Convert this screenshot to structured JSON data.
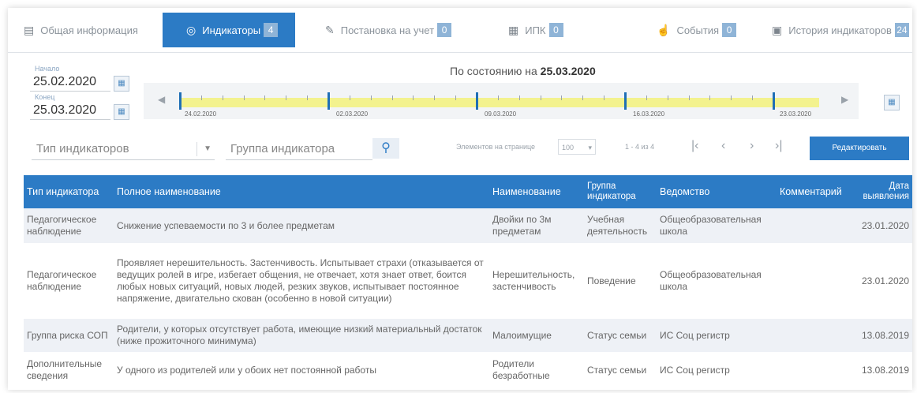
{
  "tabs": [
    {
      "icon": "id-card-icon",
      "label": "Общая информация",
      "badge": ""
    },
    {
      "icon": "target-icon",
      "label": "Индикаторы",
      "badge": "4"
    },
    {
      "icon": "edit-icon",
      "label": "Постановка на учет",
      "badge": "0"
    },
    {
      "icon": "calendar-grid-icon",
      "label": "ИПК",
      "badge": "0"
    },
    {
      "icon": "hand-pointer-icon",
      "label": "События",
      "badge": "0"
    },
    {
      "icon": "calendar-history-icon",
      "label": "История индикаторов",
      "badge": "24"
    }
  ],
  "filters": {
    "start_label": "Начало",
    "start_value": "25.02.2020",
    "end_label": "Конец",
    "end_value": "25.03.2020",
    "as_of_prefix": "По состоянию на",
    "as_of_date": "25.03.2020"
  },
  "timeline": {
    "labels": [
      "24.02.2020",
      "02.03.2020",
      "09.03.2020",
      "16.03.2020",
      "23.03.2020"
    ]
  },
  "toolbar": {
    "type_placeholder": "Тип индикаторов",
    "group_placeholder": "Группа индикатора",
    "per_page_label": "Элементов на странице",
    "per_page_value": "100",
    "range_text": "1 - 4 из 4",
    "edit_label": "Редактировать"
  },
  "table": {
    "headers": [
      "Тип индикатора",
      "Полное наименование",
      "Наименование",
      "Группа индикатора",
      "Ведомство",
      "Комментарий",
      "Дата выявления"
    ],
    "rows": [
      {
        "type": "Педагогическое наблюдение",
        "full": "Снижение успеваемости по 3 и более предметам",
        "name": "Двойки по 3м предметам",
        "group": "Учебная деятельность",
        "dept": "Общеобразовательная школа",
        "comment": "",
        "date": "23.01.2020"
      },
      {
        "type": "Педагогическое наблюдение",
        "full": "Проявляет нерешительность. Застенчивость. Испытывает страхи (отказывается от ведущих ролей в игре, избегает общения, не отвечает, хотя знает ответ, боится любых новых ситуаций, новых людей, резких звуков, испытывает постоянное напряжение, двигательно скован (особенно в новой ситуации)",
        "name": "Нерешительность, застенчивость",
        "group": "Поведение",
        "dept": "Общеобразовательная школа",
        "comment": "",
        "date": "23.01.2020"
      },
      {
        "type": "Группа риска СОП",
        "full": "Родители, у которых отсутствует работа, имеющие низкий материальный достаток (ниже прожиточного минимума)",
        "name": "Малоимущие",
        "group": "Статус семьи",
        "dept": "ИС Соц регистр",
        "comment": "",
        "date": "13.08.2019"
      },
      {
        "type": "Дополнительные сведения",
        "full": "У одного из родителей или у обоих нет постоянной работы",
        "name": "Родители безработные",
        "group": "Статус семьи",
        "dept": "ИС Соц регистр",
        "comment": "",
        "date": "13.08.2019"
      }
    ]
  }
}
